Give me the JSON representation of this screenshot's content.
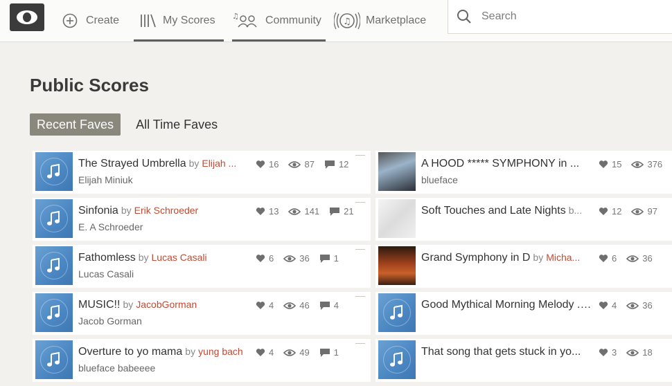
{
  "nav": {
    "create": "Create",
    "my_scores": "My Scores",
    "community": "Community",
    "marketplace": "Marketplace",
    "search_placeholder": "Search"
  },
  "page": {
    "title": "Public Scores"
  },
  "tabs": [
    {
      "label": "Recent Faves",
      "active": true
    },
    {
      "label": "All Time Faves",
      "active": false
    }
  ],
  "scores_left": [
    {
      "title": "The Strayed Umbrella",
      "by": "by",
      "author": "Elijah ...",
      "subtitle": "Elijah Miniuk",
      "likes": "16",
      "views": "87",
      "comments": "12"
    },
    {
      "title": "Sinfonia",
      "by": "by",
      "author": "Erik Schroeder",
      "subtitle": "E. A Schroeder",
      "likes": "13",
      "views": "141",
      "comments": "21"
    },
    {
      "title": "Fathomless",
      "by": "by",
      "author": "Lucas Casali",
      "subtitle": "Lucas Casali",
      "likes": "6",
      "views": "36",
      "comments": "1"
    },
    {
      "title": "MUSIC!!",
      "by": "by",
      "author": "JacobGorman",
      "subtitle": "Jacob Gorman",
      "likes": "4",
      "views": "46",
      "comments": "4"
    },
    {
      "title": "Overture to yo mama",
      "by": "by",
      "author": "yung bach",
      "subtitle": "blueface babeeee",
      "likes": "4",
      "views": "49",
      "comments": "1"
    }
  ],
  "scores_right": [
    {
      "title": "A HOOD ***** SYMPHONY in ...",
      "by": "",
      "author": "",
      "subtitle": "blueface",
      "likes": "15",
      "views": "376",
      "thumb": "photo1"
    },
    {
      "title": "Soft Touches and Late Nights",
      "by": "b...",
      "author": "",
      "subtitle": "",
      "likes": "12",
      "views": "97",
      "thumb": "photo2"
    },
    {
      "title": "Grand Symphony in D",
      "by": "by",
      "author": "Micha...",
      "subtitle": "",
      "likes": "6",
      "views": "36",
      "thumb": "photo3"
    },
    {
      "title": "Good Mythical Morning Melody ...",
      "by": "",
      "author": "",
      "subtitle": "",
      "likes": "4",
      "views": "36",
      "thumb": "note"
    },
    {
      "title": "That song that gets stuck in yo...",
      "by": "",
      "author": "",
      "subtitle": "",
      "likes": "3",
      "views": "18",
      "thumb": "note"
    }
  ],
  "icons": {
    "logo": "eye-logo-icon",
    "create": "plus-circle-icon",
    "my_scores": "bars-icon",
    "community": "people-music-icon",
    "marketplace": "music-note-circle-icon",
    "search": "search-icon",
    "like": "heart-icon",
    "view": "eye-icon",
    "comment": "comment-icon",
    "score_thumb": "music-note-icon"
  },
  "colors": {
    "author_link": "#c04a32",
    "active_tab_bg": "#8a877d",
    "thumb_blue": "#4a86c2"
  }
}
